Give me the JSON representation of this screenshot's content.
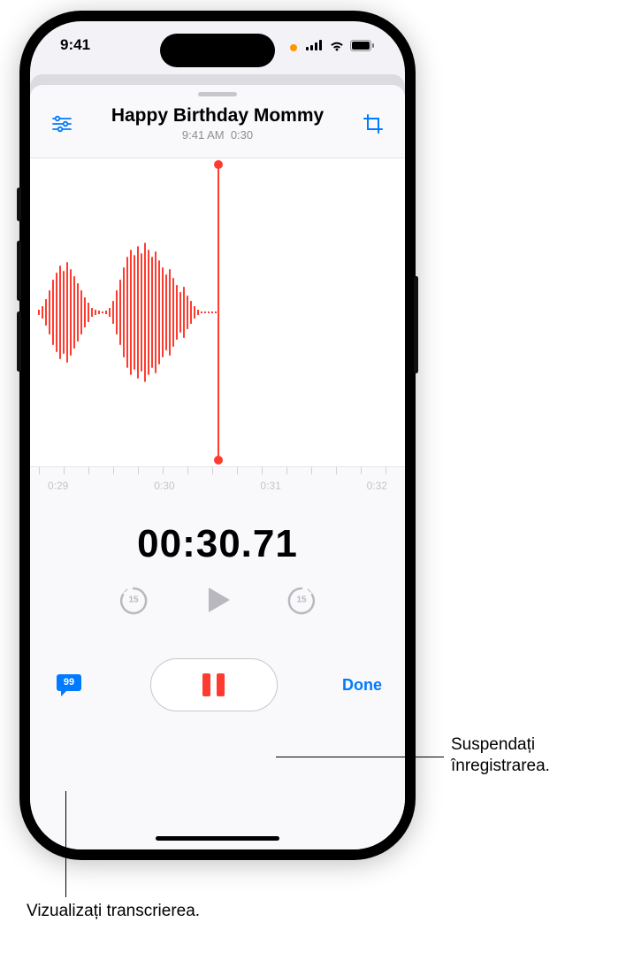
{
  "status": {
    "time": "9:41",
    "rec_dot": true
  },
  "recording": {
    "title": "Happy Birthday Mommy",
    "time_label": "9:41 AM",
    "duration_label": "0:30"
  },
  "ruler": {
    "ticks": [
      "0:29",
      "0:30",
      "0:31",
      "0:32"
    ]
  },
  "timer": "00:30.71",
  "skip_seconds": "15",
  "done_label": "Done",
  "callouts": {
    "pause": "Suspendați înregistrarea.",
    "transcribe": "Vizualizați transcrierea."
  },
  "colors": {
    "accent": "#007aff",
    "record_red": "#ff3b30"
  }
}
